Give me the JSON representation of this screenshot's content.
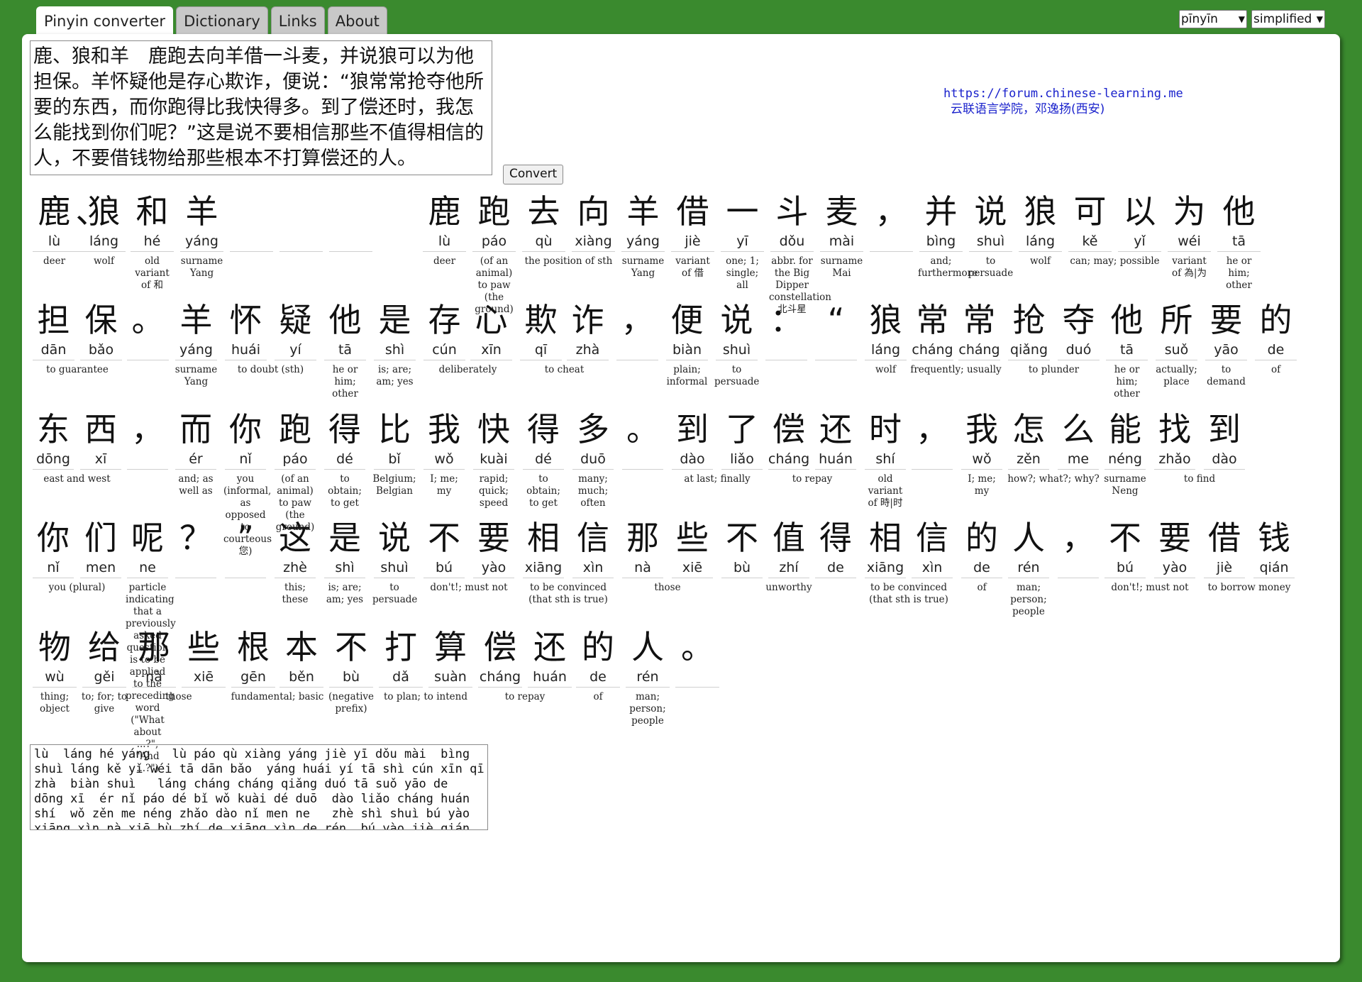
{
  "tabs": [
    "Pinyin converter",
    "Dictionary",
    "Links",
    "About"
  ],
  "selects": {
    "mode": "pīnyīn",
    "script": "simplified"
  },
  "input_text": "鹿、狼和羊　鹿跑去向羊借一斗麦，并说狼可以为他担保。羊怀疑他是存心欺诈，便说：“狼常常抢夺他所要的东西，而你跑得比我快得多。到了偿还时，我怎么能找到你们呢？”这是说不要相信那些不值得相信的人，不要借钱物给那些根本不打算偿还的人。",
  "convert_label": "Convert",
  "credit": {
    "url": "https://forum.chinese-learning.me",
    "org": "云联语言学院，邓逸扬(西安)"
  },
  "rows": [
    [
      {
        "hz": "鹿",
        "py": "lù"
      },
      {
        "hz": "、",
        "py": ""
      },
      {
        "hz": "狼",
        "py": "láng"
      },
      {
        "hz": "和",
        "py": "hé"
      },
      {
        "hz": "羊",
        "py": "yáng"
      },
      {
        "hz": "",
        "py": ""
      },
      {
        "hz": "",
        "py": ""
      },
      {
        "hz": "",
        "py": ""
      },
      {
        "hz": "鹿",
        "py": "lù"
      },
      {
        "hz": "跑",
        "py": "páo"
      },
      {
        "hz": "去",
        "py": "qù"
      },
      {
        "hz": "向",
        "py": "xiàng"
      },
      {
        "hz": "羊",
        "py": "yáng"
      },
      {
        "hz": "借",
        "py": "jiè"
      },
      {
        "hz": "一",
        "py": "yī"
      },
      {
        "hz": "斗",
        "py": "dǒu"
      },
      {
        "hz": "麦",
        "py": "mài"
      },
      {
        "hz": "，",
        "py": ""
      },
      {
        "hz": "并",
        "py": "bìng"
      },
      {
        "hz": "说",
        "py": "shuì"
      },
      {
        "hz": "狼",
        "py": "láng"
      },
      {
        "hz": "可",
        "py": "kě"
      },
      {
        "hz": "以",
        "py": "yǐ"
      },
      {
        "hz": "为",
        "py": "wéi"
      },
      {
        "hz": "他",
        "py": "tā"
      }
    ],
    [
      {
        "hz": "担",
        "py": "dān"
      },
      {
        "hz": "保",
        "py": "bǎo"
      },
      {
        "hz": "。",
        "py": ""
      },
      {
        "hz": "羊",
        "py": "yáng"
      },
      {
        "hz": "怀",
        "py": "huái"
      },
      {
        "hz": "疑",
        "py": "yí"
      },
      {
        "hz": "他",
        "py": "tā"
      },
      {
        "hz": "是",
        "py": "shì"
      },
      {
        "hz": "存",
        "py": "cún"
      },
      {
        "hz": "心",
        "py": "xīn"
      },
      {
        "hz": "欺",
        "py": "qī"
      },
      {
        "hz": "诈",
        "py": "zhà"
      },
      {
        "hz": "，",
        "py": ""
      },
      {
        "hz": "便",
        "py": "biàn"
      },
      {
        "hz": "说",
        "py": "shuì"
      },
      {
        "hz": "：",
        "py": ""
      },
      {
        "hz": "“",
        "py": ""
      },
      {
        "hz": "狼",
        "py": "láng"
      },
      {
        "hz": "常",
        "py": "cháng"
      },
      {
        "hz": "常",
        "py": "cháng"
      },
      {
        "hz": "抢",
        "py": "qiǎng"
      },
      {
        "hz": "夺",
        "py": "duó"
      },
      {
        "hz": "他",
        "py": "tā"
      },
      {
        "hz": "所",
        "py": "suǒ"
      },
      {
        "hz": "要",
        "py": "yāo"
      },
      {
        "hz": "的",
        "py": "de"
      }
    ],
    [
      {
        "hz": "东",
        "py": "dōng"
      },
      {
        "hz": "西",
        "py": "xī"
      },
      {
        "hz": "，",
        "py": ""
      },
      {
        "hz": "而",
        "py": "ér"
      },
      {
        "hz": "你",
        "py": "nǐ"
      },
      {
        "hz": "跑",
        "py": "páo"
      },
      {
        "hz": "得",
        "py": "dé"
      },
      {
        "hz": "比",
        "py": "bǐ"
      },
      {
        "hz": "我",
        "py": "wǒ"
      },
      {
        "hz": "快",
        "py": "kuài"
      },
      {
        "hz": "得",
        "py": "dé"
      },
      {
        "hz": "多",
        "py": "duō"
      },
      {
        "hz": "。",
        "py": ""
      },
      {
        "hz": "到",
        "py": "dào"
      },
      {
        "hz": "了",
        "py": "liǎo"
      },
      {
        "hz": "偿",
        "py": "cháng"
      },
      {
        "hz": "还",
        "py": "huán"
      },
      {
        "hz": "时",
        "py": "shí"
      },
      {
        "hz": "，",
        "py": ""
      },
      {
        "hz": "我",
        "py": "wǒ"
      },
      {
        "hz": "怎",
        "py": "zěn"
      },
      {
        "hz": "么",
        "py": "me"
      },
      {
        "hz": "能",
        "py": "néng"
      },
      {
        "hz": "找",
        "py": "zhǎo"
      },
      {
        "hz": "到",
        "py": "dào"
      }
    ],
    [
      {
        "hz": "你",
        "py": "nǐ"
      },
      {
        "hz": "们",
        "py": "men"
      },
      {
        "hz": "呢",
        "py": "ne"
      },
      {
        "hz": "？",
        "py": ""
      },
      {
        "hz": "”",
        "py": ""
      },
      {
        "hz": "这",
        "py": "zhè"
      },
      {
        "hz": "是",
        "py": "shì"
      },
      {
        "hz": "说",
        "py": "shuì"
      },
      {
        "hz": "不",
        "py": "bú"
      },
      {
        "hz": "要",
        "py": "yào"
      },
      {
        "hz": "相",
        "py": "xiāng"
      },
      {
        "hz": "信",
        "py": "xìn"
      },
      {
        "hz": "那",
        "py": "nà"
      },
      {
        "hz": "些",
        "py": "xiē"
      },
      {
        "hz": "不",
        "py": "bù"
      },
      {
        "hz": "值",
        "py": "zhí"
      },
      {
        "hz": "得",
        "py": "de"
      },
      {
        "hz": "相",
        "py": "xiāng"
      },
      {
        "hz": "信",
        "py": "xìn"
      },
      {
        "hz": "的",
        "py": "de"
      },
      {
        "hz": "人",
        "py": "rén"
      },
      {
        "hz": "，",
        "py": ""
      },
      {
        "hz": "不",
        "py": "bú"
      },
      {
        "hz": "要",
        "py": "yào"
      },
      {
        "hz": "借",
        "py": "jiè"
      },
      {
        "hz": "钱",
        "py": "qián"
      }
    ],
    [
      {
        "hz": "物",
        "py": "wù"
      },
      {
        "hz": "给",
        "py": "gěi"
      },
      {
        "hz": "那",
        "py": "nà"
      },
      {
        "hz": "些",
        "py": "xiē"
      },
      {
        "hz": "根",
        "py": "gēn"
      },
      {
        "hz": "本",
        "py": "běn"
      },
      {
        "hz": "不",
        "py": "bù"
      },
      {
        "hz": "打",
        "py": "dǎ"
      },
      {
        "hz": "算",
        "py": "suàn"
      },
      {
        "hz": "偿",
        "py": "cháng"
      },
      {
        "hz": "还",
        "py": "huán"
      },
      {
        "hz": "的",
        "py": "de"
      },
      {
        "hz": "人",
        "py": "rén"
      },
      {
        "hz": "。",
        "py": ""
      }
    ]
  ],
  "glosses": [
    [
      "deer",
      "wolf",
      "old variant of 和",
      "surname Yang",
      "deer",
      "(of an animal) to paw (the ground)",
      "the position of sth",
      "surname Yang",
      "variant of 借",
      "one; 1; single; all",
      "abbr. for the Big Dipper constellation 北斗星",
      "surname Mai",
      "and; furthermore",
      "to persuade",
      "wolf",
      "can; may; possible",
      "variant of 為|为",
      "he or him; other"
    ],
    [
      "to guarantee",
      "surname Yang",
      "to doubt (sth)",
      "he or him; other",
      "is; are; am; yes",
      "deliberately",
      "to cheat",
      "plain; informal",
      "to persuade",
      "wolf",
      "frequently; usually",
      "to plunder",
      "he or him; other",
      "actually; place",
      "to demand",
      "of"
    ],
    [
      "east and west",
      "and; as well as",
      "you (informal, as opposed to courteous 您)",
      "(of an animal) to paw (the ground)",
      "to obtain; to get",
      "Belgium; Belgian",
      "I; me; my",
      "rapid; quick; speed",
      "to obtain; to get",
      "many; much; often",
      "at last; finally",
      "to repay",
      "old variant of 時|时",
      "I; me; my",
      "how?; what?; why?",
      "surname Neng",
      "to find"
    ],
    [
      "you (plural)",
      "particle indicating that a previously asked question is to be applied to the preceding word (\"What about ...?\", \"And ...?\")",
      "this; these",
      "is; are; am; yes",
      "to persuade",
      "don't!; must not",
      "to be convinced (that sth is true)",
      "those",
      "unworthy",
      "to be convinced (that sth is true)",
      "of",
      "man; person; people",
      "don't!; must not",
      "to borrow money"
    ],
    [
      "thing; object",
      "to; for; to give",
      "those",
      "fundamental; basic",
      "(negative prefix)",
      "to plan; to intend",
      "to repay",
      "of",
      "man; person; people"
    ]
  ],
  "output_text": "lù  láng hé yáng   lù páo qù xiàng yáng jiè yī dǒu mài  bìng\nshuì láng kě yǐ wéi tā dān bǎo  yáng huái yí tā shì cún xīn qī\nzhà  biàn shuì   láng cháng cháng qiǎng duó tā suǒ yāo de\ndōng xī  ér nǐ páo dé bǐ wǒ kuài dé duō  dào liǎo cháng huán\nshí  wǒ zěn me néng zhǎo dào nǐ men ne   zhè shì shuì bú yào\nxiāng xìn nà xiē bù zhí de xiāng xìn de rén  bú yào jiè qián"
}
